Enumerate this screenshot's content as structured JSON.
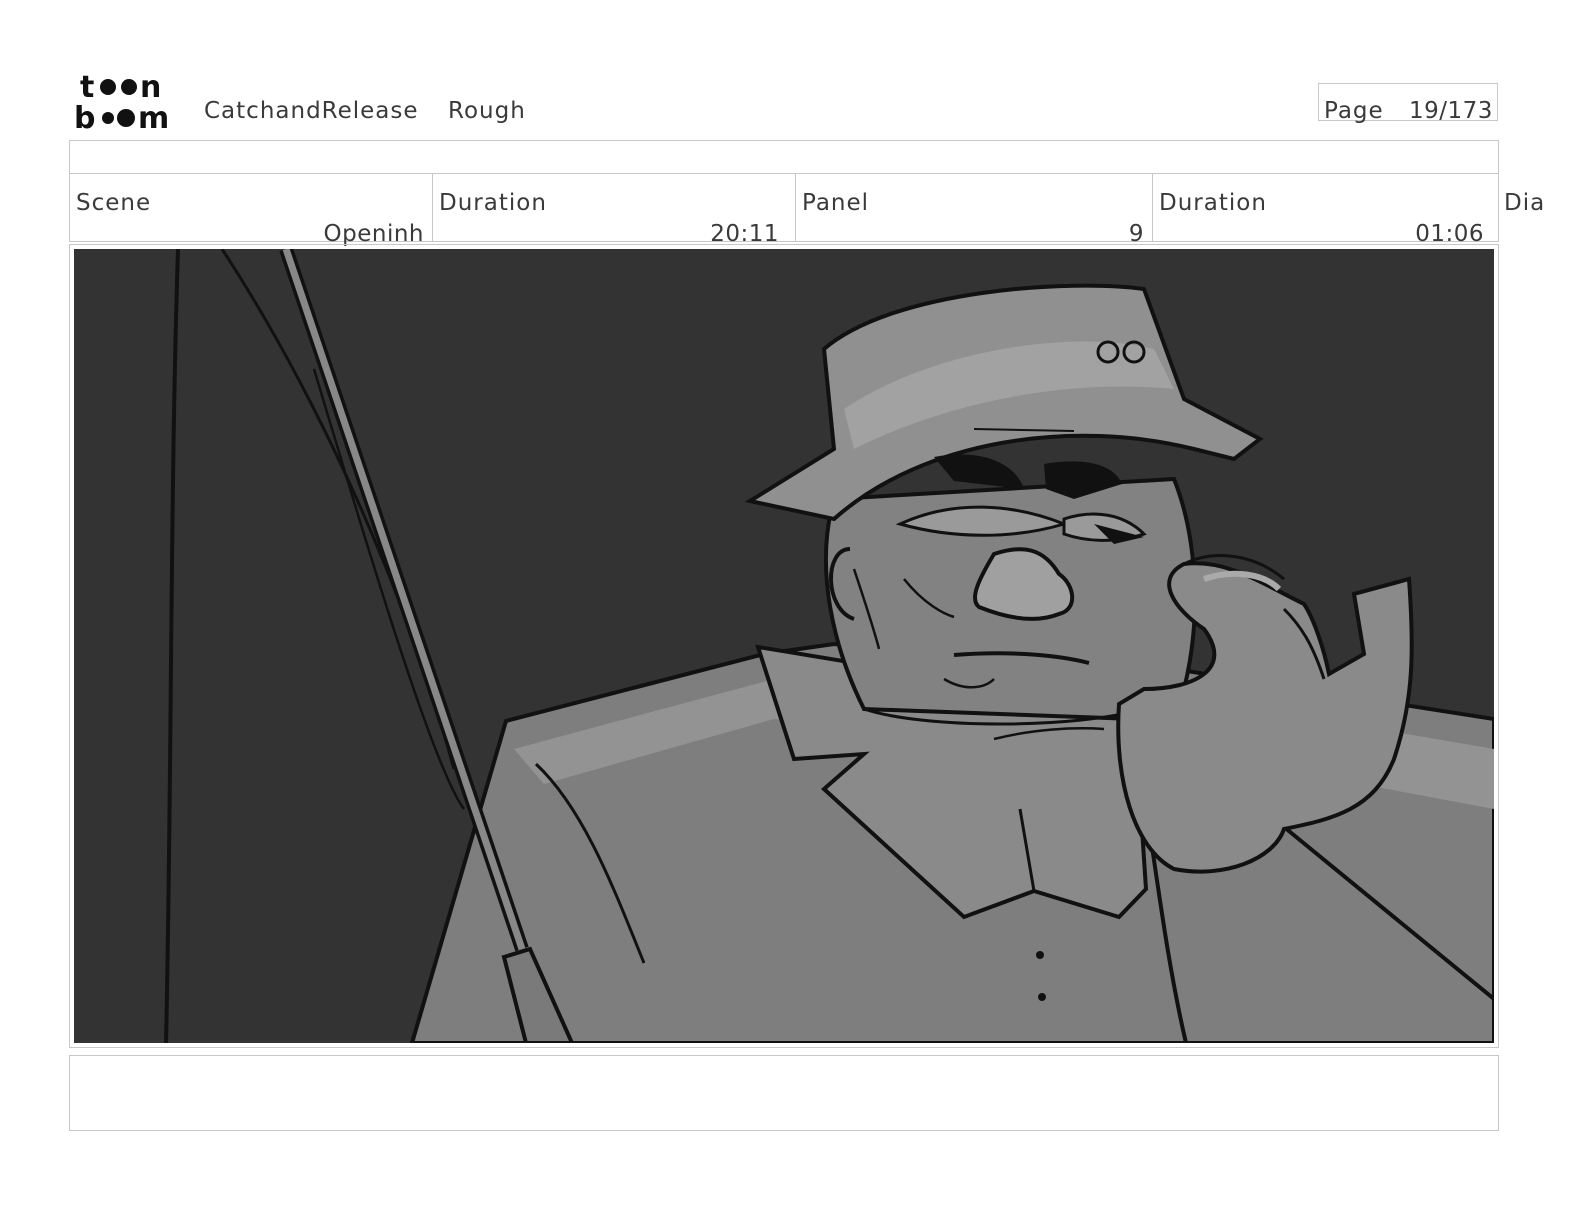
{
  "header": {
    "logo_text": "toon boom",
    "project": "CatchandRelease",
    "stage": "Rough",
    "page_label": "Page",
    "page_value": "19/173"
  },
  "info": {
    "scene_label": "Scene",
    "scene_value": "Openinh",
    "scene_duration_label": "Duration",
    "scene_duration_value": "20:11",
    "panel_label": "Panel",
    "panel_value": "9",
    "panel_duration_label": "Duration",
    "panel_duration_value": "01:06",
    "dialogue_label": "Dia"
  },
  "colors": {
    "background": "#ffffff",
    "border": "#c8c8c8",
    "panel_bg": "#333333",
    "character_mid": "#7a7a7a",
    "character_light": "#999999"
  }
}
